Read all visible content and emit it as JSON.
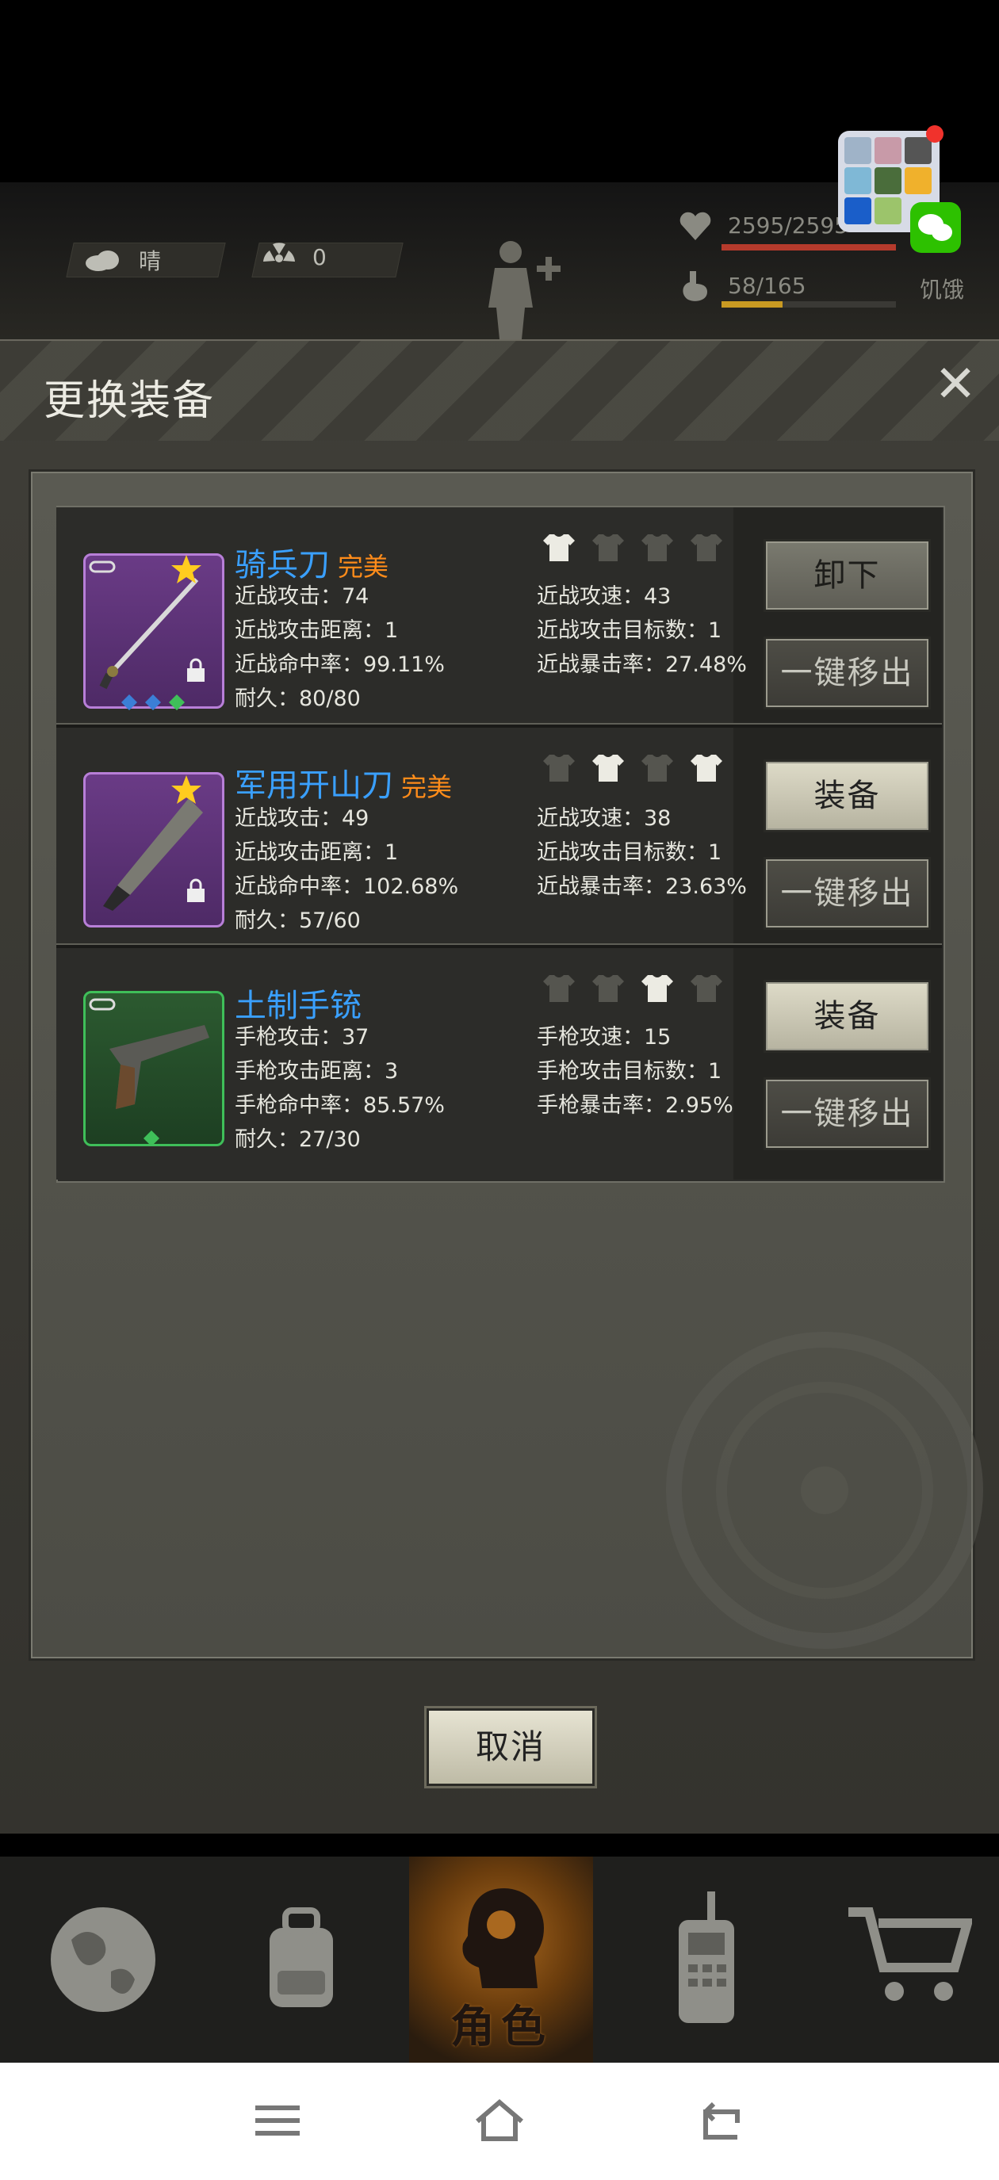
{
  "status": {
    "weather": "晴",
    "radiation": "0",
    "hp": "2595/2595",
    "hunger": "58/165",
    "hunger_label": "饥饿",
    "hp_fraction": 1.0,
    "hunger_fraction": 0.35
  },
  "dialog": {
    "title": "更换装备",
    "close_icon": "close-icon",
    "cancel_label": "取消"
  },
  "items": [
    {
      "name": "骑兵刀",
      "quality": "完美",
      "stats": {
        "a1": "近战攻击：74",
        "a2": "近战攻击距离：1",
        "a3": "近战命中率：99.11%",
        "a4": "耐久：80/80",
        "b1": "近战攻速：43",
        "b2": "近战攻击目标数：1",
        "b3": "近战暴击率：27.48%"
      },
      "primary_button": "卸下",
      "remove_button": "一键移出"
    },
    {
      "name": "军用开山刀",
      "quality": "完美",
      "stats": {
        "a1": "近战攻击：49",
        "a2": "近战攻击距离：1",
        "a3": "近战命中率：102.68%",
        "a4": "耐久：57/60",
        "b1": "近战攻速：38",
        "b2": "近战攻击目标数：1",
        "b3": "近战暴击率：23.63%"
      },
      "primary_button": "装备",
      "remove_button": "一键移出"
    },
    {
      "name": "土制手铳",
      "quality": "",
      "stats": {
        "a1": "手枪攻击：37",
        "a2": "手枪攻击距离：3",
        "a3": "手枪命中率：85.57%",
        "a4": "耐久：27/30",
        "b1": "手枪攻速：15",
        "b2": "手枪攻击目标数：1",
        "b3": "手枪暴击率：2.95%"
      },
      "primary_button": "装备",
      "remove_button": "一键移出"
    }
  ],
  "bottom_nav": {
    "active_label": "角色"
  },
  "colors": {
    "name_blue": "#3aa0ff",
    "quality_orange": "#ff8c1a",
    "hp_red": "#b53a2c",
    "hunger_yellow": "#c99a22"
  }
}
